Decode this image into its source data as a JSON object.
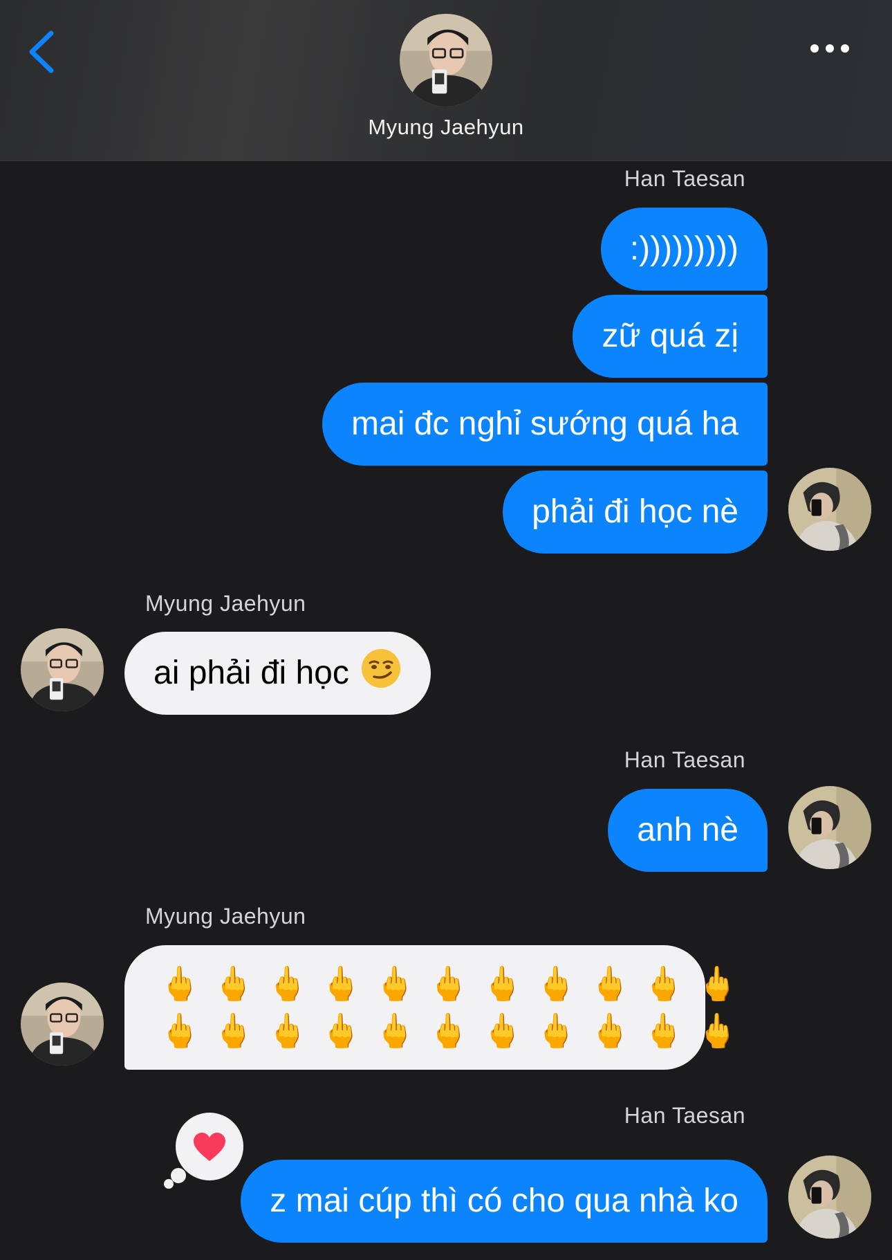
{
  "header": {
    "contact_name": "Myung Jaehyun",
    "back_icon": "chevron-left-icon",
    "more_icon": "ellipsis-icon",
    "accent_color": "#0b84fe"
  },
  "messages": {
    "group1": {
      "sender": "Han Taesan",
      "texts": [
        ":)))))))))",
        "zữ quá zị",
        "mai đc nghỉ sướng quá ha",
        "phải đi học nè"
      ]
    },
    "group2": {
      "sender": "Myung Jaehyun",
      "text": "ai phải đi học",
      "emoji": "smirking-face"
    },
    "group3": {
      "sender": "Han Taesan",
      "text": "anh nè"
    },
    "group4": {
      "sender": "Myung Jaehyun",
      "emoji_row1": "🖕🖕🖕🖕🖕🖕🖕🖕🖕🖕🖕",
      "emoji_row2": "🖕🖕🖕🖕🖕🖕🖕🖕🖕🖕🖕"
    },
    "group5": {
      "sender": "Han Taesan",
      "text": "z mai cúp thì có cho qua nhà ko",
      "reaction": "heart-icon"
    }
  },
  "colors": {
    "outgoing_bubble": "#0b84fe",
    "incoming_bubble": "#f2f2f4",
    "background": "#1b1b1d",
    "reaction_heart": "#fa3a5a"
  }
}
